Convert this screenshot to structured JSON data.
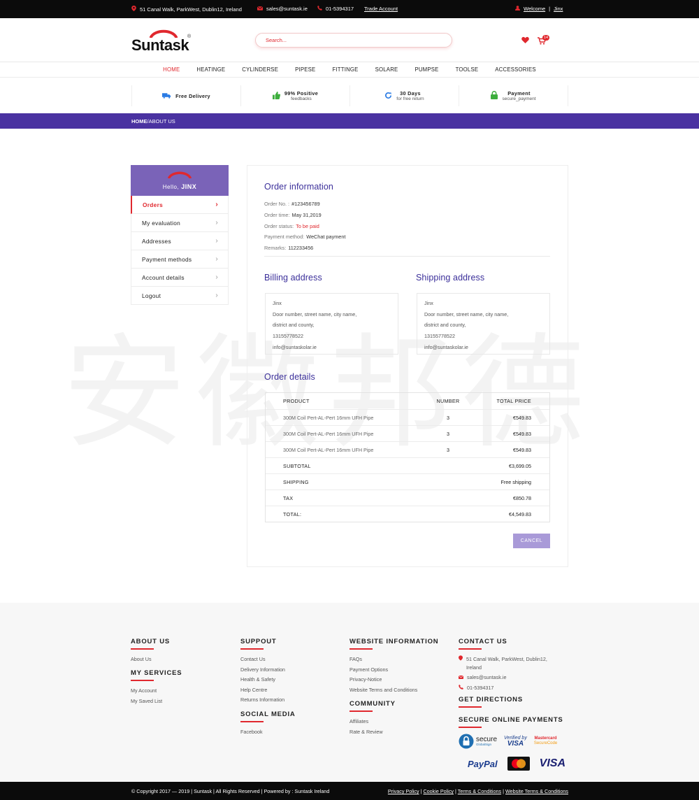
{
  "topbar": {
    "address": "51 Canal Walk,  ParkWest,  Dublin12,  Ireland",
    "email": "sales@suntask.ie",
    "phone": "01-5394317",
    "trade_account": "Trade Account",
    "welcome": "Welcome",
    "separator": "|",
    "user": "Jinx"
  },
  "header": {
    "logo_text": "Suntask",
    "search_placeholder": "Search...",
    "cart_count": "14"
  },
  "nav": [
    "HOME",
    "HEATINGE",
    "CYLINDERSE",
    "PIPESE",
    "FITTINGE",
    "SOLARE",
    "PUMPSE",
    "TOOLSE",
    "ACCESSORIES"
  ],
  "features": [
    {
      "title": "Free Delivery",
      "sub": ""
    },
    {
      "title": "99% Positive",
      "sub": "feedbacks"
    },
    {
      "title": "30 Days",
      "sub": "for free return"
    },
    {
      "title": "Payment",
      "sub": "secure_payment"
    }
  ],
  "breadcrumb": {
    "home": "HOME",
    "sep": "/",
    "current": "ABOUT US"
  },
  "watermark": "安徽邦德",
  "sidebar": {
    "hello": "Hello,",
    "name": "JINX",
    "items": [
      "Orders",
      "My evaluation",
      "Addresses",
      "Payment methods",
      "Account details",
      "Logout"
    ]
  },
  "order": {
    "title": "Order information",
    "no_label": "Order No.  :",
    "no_value": "#123456789",
    "time_label": "Order time:",
    "time_value": "May 31,2019",
    "status_label": "Order status:",
    "status_value": "To be paid",
    "method_label": "Payment method:",
    "method_value": "WeChat payment",
    "remarks_label": "Remarks:",
    "remarks_value": "112233456"
  },
  "billing": {
    "title": "Billing address",
    "name": "Jinx",
    "line1": "Door number, street name, city name,",
    "line2": "district and county,",
    "phone": "13155778522",
    "email": "info@suntaskolar.ie"
  },
  "shipping": {
    "title": "Shipping address",
    "name": "Jinx",
    "line1": "Door number, street name, city name,",
    "line2": "district and county,",
    "phone": "13155778522",
    "email": "info@suntaskolar.ie"
  },
  "details": {
    "title": "Order details",
    "headers": {
      "product": "PRODUCT",
      "number": "NUMBER",
      "total": "TOTAL PRICE"
    },
    "rows": [
      {
        "product": "300M Coil Pert-AL-Pert 16mm UFH Pipe",
        "number": "3",
        "price": "€549.83"
      },
      {
        "product": "300M Coil Pert-AL-Pert 16mm UFH Pipe",
        "number": "3",
        "price": "€549.83"
      },
      {
        "product": "300M Coil Pert-AL-Pert 16mm UFH Pipe",
        "number": "3",
        "price": "€549.83"
      }
    ],
    "subtotal_label": "SUBTOTAL",
    "subtotal": "€3,699.05",
    "shipping_label": "SHIPPING",
    "shipping": "Free shipping",
    "tax_label": "TAX",
    "tax": "€850.78",
    "total_label": "TOTAL:",
    "total": "€4,549.83",
    "cancel": "CANCEL"
  },
  "footer": {
    "about": {
      "title": "ABOUT US",
      "links": [
        "About Us"
      ]
    },
    "services": {
      "title": "MY SERVICES",
      "links": [
        "My Account",
        "My Saved List"
      ]
    },
    "support": {
      "title": "SUPPOUT",
      "links": [
        "Contact Us",
        "Delivery Information",
        "Health & Safety",
        "Help Centre",
        "Returns Information"
      ]
    },
    "social": {
      "title": "SOCIAL MEDIA",
      "links": [
        "Facebook"
      ]
    },
    "website": {
      "title": "WEBSITE INFORMATION",
      "links": [
        "FAQs",
        "Payment Options",
        "Privacy-Notice",
        "Website Terms and Conditions"
      ]
    },
    "community": {
      "title": "COMMUNITY",
      "links": [
        "Affiliates",
        "Rate & Review"
      ]
    },
    "contact": {
      "title": "CONTACT US",
      "address1": "51 Canal Walk,  ParkWest,  Dublin12,",
      "address2": "Ireland",
      "email": "sales@suntask.ie",
      "phone": "01-5394317"
    },
    "directions": {
      "title": "GET DIRECTIONS"
    },
    "payments": {
      "title": "SECURE ONLINE PAYMENTS",
      "secure": "secure",
      "globalsign": "GlobalSign",
      "verified": "Verified by",
      "visa": "VISA",
      "mastercard": "Mastercard",
      "securecode": "SecureCode",
      "paypal": "PayPal"
    }
  },
  "copyright": {
    "text": "© Copyright 2017 — 2019 | Suntask | All Rights Reserved | Powered by : Suntask Ireland",
    "links": [
      "Privacy Policy",
      "Cookie Policy",
      "Terms & Conditions",
      "Website Terms & Conditions"
    ],
    "sep": "|"
  },
  "colors": {
    "accent": "#e0282e",
    "brand_purple": "#4a32a1",
    "sidebar_purple": "#7a63b8",
    "cancel": "#a99ad8"
  }
}
